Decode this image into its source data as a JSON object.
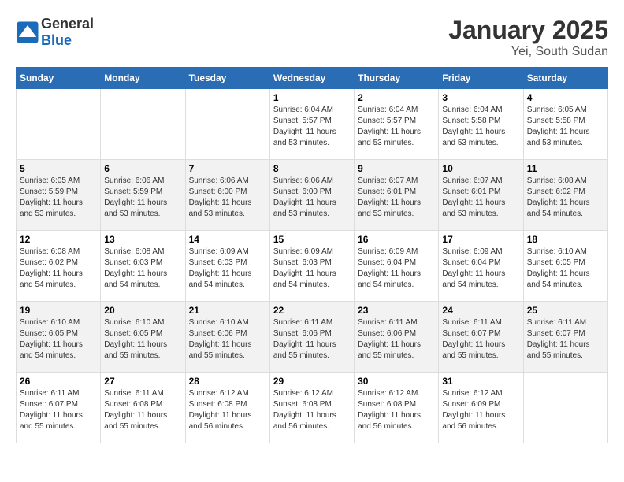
{
  "header": {
    "logo_general": "General",
    "logo_blue": "Blue",
    "title": "January 2025",
    "subtitle": "Yei, South Sudan"
  },
  "days_of_week": [
    "Sunday",
    "Monday",
    "Tuesday",
    "Wednesday",
    "Thursday",
    "Friday",
    "Saturday"
  ],
  "weeks": [
    [
      {
        "day": "",
        "info": ""
      },
      {
        "day": "",
        "info": ""
      },
      {
        "day": "",
        "info": ""
      },
      {
        "day": "1",
        "info": "Sunrise: 6:04 AM\nSunset: 5:57 PM\nDaylight: 11 hours and 53 minutes."
      },
      {
        "day": "2",
        "info": "Sunrise: 6:04 AM\nSunset: 5:57 PM\nDaylight: 11 hours and 53 minutes."
      },
      {
        "day": "3",
        "info": "Sunrise: 6:04 AM\nSunset: 5:58 PM\nDaylight: 11 hours and 53 minutes."
      },
      {
        "day": "4",
        "info": "Sunrise: 6:05 AM\nSunset: 5:58 PM\nDaylight: 11 hours and 53 minutes."
      }
    ],
    [
      {
        "day": "5",
        "info": "Sunrise: 6:05 AM\nSunset: 5:59 PM\nDaylight: 11 hours and 53 minutes."
      },
      {
        "day": "6",
        "info": "Sunrise: 6:06 AM\nSunset: 5:59 PM\nDaylight: 11 hours and 53 minutes."
      },
      {
        "day": "7",
        "info": "Sunrise: 6:06 AM\nSunset: 6:00 PM\nDaylight: 11 hours and 53 minutes."
      },
      {
        "day": "8",
        "info": "Sunrise: 6:06 AM\nSunset: 6:00 PM\nDaylight: 11 hours and 53 minutes."
      },
      {
        "day": "9",
        "info": "Sunrise: 6:07 AM\nSunset: 6:01 PM\nDaylight: 11 hours and 53 minutes."
      },
      {
        "day": "10",
        "info": "Sunrise: 6:07 AM\nSunset: 6:01 PM\nDaylight: 11 hours and 53 minutes."
      },
      {
        "day": "11",
        "info": "Sunrise: 6:08 AM\nSunset: 6:02 PM\nDaylight: 11 hours and 54 minutes."
      }
    ],
    [
      {
        "day": "12",
        "info": "Sunrise: 6:08 AM\nSunset: 6:02 PM\nDaylight: 11 hours and 54 minutes."
      },
      {
        "day": "13",
        "info": "Sunrise: 6:08 AM\nSunset: 6:03 PM\nDaylight: 11 hours and 54 minutes."
      },
      {
        "day": "14",
        "info": "Sunrise: 6:09 AM\nSunset: 6:03 PM\nDaylight: 11 hours and 54 minutes."
      },
      {
        "day": "15",
        "info": "Sunrise: 6:09 AM\nSunset: 6:03 PM\nDaylight: 11 hours and 54 minutes."
      },
      {
        "day": "16",
        "info": "Sunrise: 6:09 AM\nSunset: 6:04 PM\nDaylight: 11 hours and 54 minutes."
      },
      {
        "day": "17",
        "info": "Sunrise: 6:09 AM\nSunset: 6:04 PM\nDaylight: 11 hours and 54 minutes."
      },
      {
        "day": "18",
        "info": "Sunrise: 6:10 AM\nSunset: 6:05 PM\nDaylight: 11 hours and 54 minutes."
      }
    ],
    [
      {
        "day": "19",
        "info": "Sunrise: 6:10 AM\nSunset: 6:05 PM\nDaylight: 11 hours and 54 minutes."
      },
      {
        "day": "20",
        "info": "Sunrise: 6:10 AM\nSunset: 6:05 PM\nDaylight: 11 hours and 55 minutes."
      },
      {
        "day": "21",
        "info": "Sunrise: 6:10 AM\nSunset: 6:06 PM\nDaylight: 11 hours and 55 minutes."
      },
      {
        "day": "22",
        "info": "Sunrise: 6:11 AM\nSunset: 6:06 PM\nDaylight: 11 hours and 55 minutes."
      },
      {
        "day": "23",
        "info": "Sunrise: 6:11 AM\nSunset: 6:06 PM\nDaylight: 11 hours and 55 minutes."
      },
      {
        "day": "24",
        "info": "Sunrise: 6:11 AM\nSunset: 6:07 PM\nDaylight: 11 hours and 55 minutes."
      },
      {
        "day": "25",
        "info": "Sunrise: 6:11 AM\nSunset: 6:07 PM\nDaylight: 11 hours and 55 minutes."
      }
    ],
    [
      {
        "day": "26",
        "info": "Sunrise: 6:11 AM\nSunset: 6:07 PM\nDaylight: 11 hours and 55 minutes."
      },
      {
        "day": "27",
        "info": "Sunrise: 6:11 AM\nSunset: 6:08 PM\nDaylight: 11 hours and 55 minutes."
      },
      {
        "day": "28",
        "info": "Sunrise: 6:12 AM\nSunset: 6:08 PM\nDaylight: 11 hours and 56 minutes."
      },
      {
        "day": "29",
        "info": "Sunrise: 6:12 AM\nSunset: 6:08 PM\nDaylight: 11 hours and 56 minutes."
      },
      {
        "day": "30",
        "info": "Sunrise: 6:12 AM\nSunset: 6:08 PM\nDaylight: 11 hours and 56 minutes."
      },
      {
        "day": "31",
        "info": "Sunrise: 6:12 AM\nSunset: 6:09 PM\nDaylight: 11 hours and 56 minutes."
      },
      {
        "day": "",
        "info": ""
      }
    ]
  ]
}
